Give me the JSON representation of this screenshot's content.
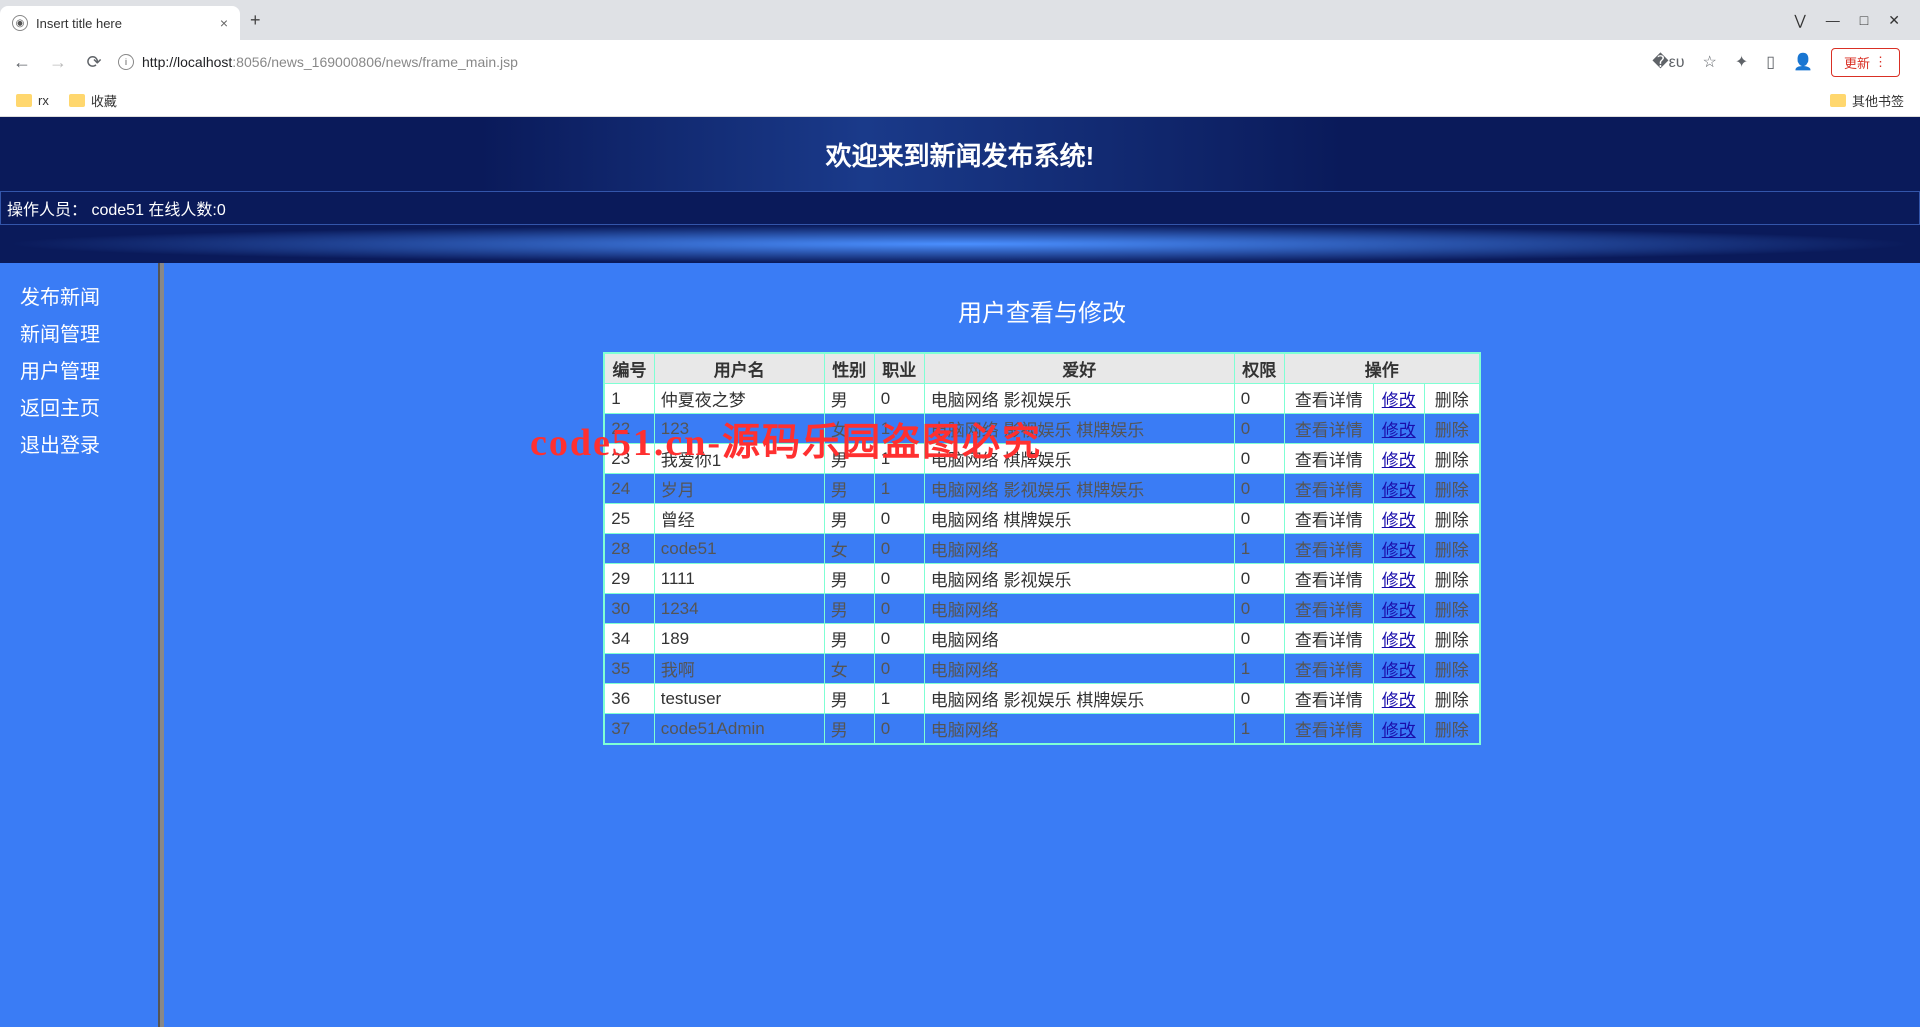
{
  "browser": {
    "tab_title": "Insert title here",
    "url_host": "http://localhost",
    "url_port": ":8056",
    "url_path": "/news_169000806/news/frame_main.jsp",
    "update_label": "更新",
    "bookmarks": {
      "rx": "rx",
      "fav": "收藏",
      "other": "其他书签"
    }
  },
  "banner": {
    "title": "欢迎来到新闻发布系统!"
  },
  "status": {
    "operator_label": "操作人员：",
    "operator_value": "code51",
    "online_label": "在线人数:",
    "online_value": "0"
  },
  "sidebar": {
    "items": [
      {
        "label": "发布新闻"
      },
      {
        "label": "新闻管理"
      },
      {
        "label": "用户管理"
      },
      {
        "label": "返回主页"
      },
      {
        "label": "退出登录"
      }
    ]
  },
  "main": {
    "title": "用户查看与修改",
    "headers": {
      "id": "编号",
      "name": "用户名",
      "gender": "性别",
      "job": "职业",
      "hobby": "爱好",
      "perm": "权限",
      "op": "操作"
    },
    "op_labels": {
      "view": "查看详情",
      "edit": "修改",
      "del": "删除"
    },
    "rows": [
      {
        "id": "1",
        "name": "仲夏夜之梦",
        "gender": "男",
        "job": "0",
        "hobby": "电脑网络 影视娱乐",
        "perm": "0"
      },
      {
        "id": "22",
        "name": "123",
        "gender": "女",
        "job": "1",
        "hobby": "电脑网络 影视娱乐 棋牌娱乐",
        "perm": "0"
      },
      {
        "id": "23",
        "name": "我爱你1",
        "gender": "男",
        "job": "1",
        "hobby": "电脑网络 棋牌娱乐",
        "perm": "0"
      },
      {
        "id": "24",
        "name": "岁月",
        "gender": "男",
        "job": "1",
        "hobby": "电脑网络 影视娱乐 棋牌娱乐",
        "perm": "0"
      },
      {
        "id": "25",
        "name": "曾经",
        "gender": "男",
        "job": "0",
        "hobby": "电脑网络 棋牌娱乐",
        "perm": "0"
      },
      {
        "id": "28",
        "name": "code51",
        "gender": "女",
        "job": "0",
        "hobby": "电脑网络",
        "perm": "1"
      },
      {
        "id": "29",
        "name": "1111",
        "gender": "男",
        "job": "0",
        "hobby": "电脑网络 影视娱乐",
        "perm": "0"
      },
      {
        "id": "30",
        "name": "1234",
        "gender": "男",
        "job": "0",
        "hobby": "电脑网络",
        "perm": "0"
      },
      {
        "id": "34",
        "name": "189",
        "gender": "男",
        "job": "0",
        "hobby": "电脑网络",
        "perm": "0"
      },
      {
        "id": "35",
        "name": "我啊",
        "gender": "女",
        "job": "0",
        "hobby": "电脑网络",
        "perm": "1"
      },
      {
        "id": "36",
        "name": "testuser",
        "gender": "男",
        "job": "1",
        "hobby": "电脑网络 影视娱乐 棋牌娱乐",
        "perm": "0"
      },
      {
        "id": "37",
        "name": "code51Admin",
        "gender": "男",
        "job": "0",
        "hobby": "电脑网络",
        "perm": "1"
      }
    ]
  },
  "watermark": "code51.cn-源码乐园盗图必究"
}
